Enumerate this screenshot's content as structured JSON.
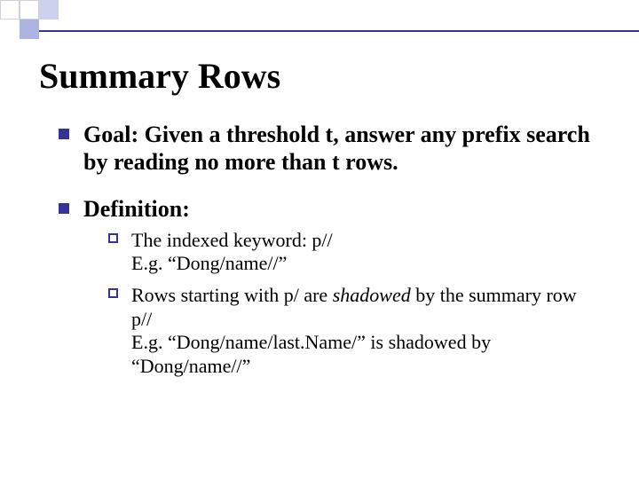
{
  "title": "Summary Rows",
  "bullets": {
    "goal": "Goal: Given a threshold t, answer any prefix search by reading no more than t rows.",
    "definition_label": "Definition:",
    "sub1": {
      "line1a": "The indexed keyword: p//",
      "line2": "E.g. “Dong/name//”"
    },
    "sub2": {
      "line1a": "Rows starting with p/ are ",
      "line1b_italic": "shadowed",
      "line1c": " by the summary row p//",
      "line2": "E.g. “Dong/name/last.Name/” is shadowed by “Dong/name//”"
    }
  },
  "colors": {
    "accent": "#333399",
    "light": "#c5cae9",
    "mid": "#9fa8da"
  }
}
